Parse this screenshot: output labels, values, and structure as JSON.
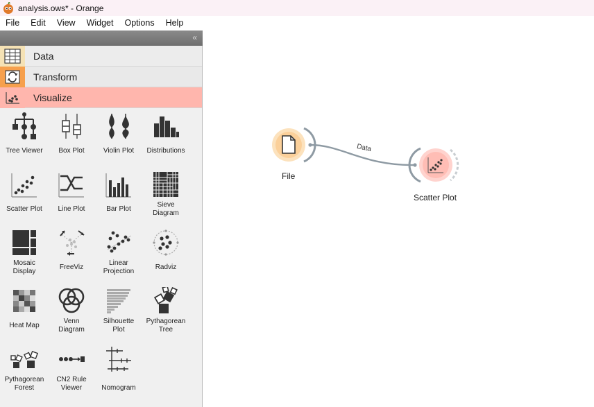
{
  "window": {
    "title": "analysis.ows* - Orange"
  },
  "menu": [
    {
      "label": "File"
    },
    {
      "label": "Edit"
    },
    {
      "label": "View"
    },
    {
      "label": "Widget"
    },
    {
      "label": "Options"
    },
    {
      "label": "Help"
    }
  ],
  "categories": {
    "data": "Data",
    "transform": "Transform",
    "visualize": "Visualize"
  },
  "widgets": [
    {
      "label": "Tree Viewer",
      "icon": "tree-viewer-icon"
    },
    {
      "label": "Box Plot",
      "icon": "box-plot-icon"
    },
    {
      "label": "Violin Plot",
      "icon": "violin-plot-icon"
    },
    {
      "label": "Distributions",
      "icon": "distributions-icon"
    },
    {
      "label": "Scatter Plot",
      "icon": "scatter-plot-icon"
    },
    {
      "label": "Line Plot",
      "icon": "line-plot-icon"
    },
    {
      "label": "Bar Plot",
      "icon": "bar-plot-icon"
    },
    {
      "label": "Sieve\nDiagram",
      "icon": "sieve-diagram-icon"
    },
    {
      "label": "Mosaic\nDisplay",
      "icon": "mosaic-display-icon"
    },
    {
      "label": "FreeViz",
      "icon": "freeviz-icon"
    },
    {
      "label": "Linear\nProjection",
      "icon": "linear-projection-icon"
    },
    {
      "label": "Radviz",
      "icon": "radviz-icon"
    },
    {
      "label": "Heat Map",
      "icon": "heat-map-icon"
    },
    {
      "label": "Venn\nDiagram",
      "icon": "venn-diagram-icon"
    },
    {
      "label": "Silhouette\nPlot",
      "icon": "silhouette-plot-icon"
    },
    {
      "label": "Pythagorean\nTree",
      "icon": "pythagorean-tree-icon"
    },
    {
      "label": "Pythagorean\nForest",
      "icon": "pythagorean-forest-icon"
    },
    {
      "label": "CN2 Rule\nViewer",
      "icon": "cn2-rule-viewer-icon"
    },
    {
      "label": "Nomogram",
      "icon": "nomogram-icon"
    }
  ],
  "canvas": {
    "nodes": [
      {
        "label": "File",
        "icon": "file-icon",
        "color": "#fbd9a6"
      },
      {
        "label": "Scatter Plot",
        "icon": "scatter-plot-icon",
        "color": "#ffc4bd"
      }
    ],
    "link": {
      "label": "Data"
    }
  }
}
